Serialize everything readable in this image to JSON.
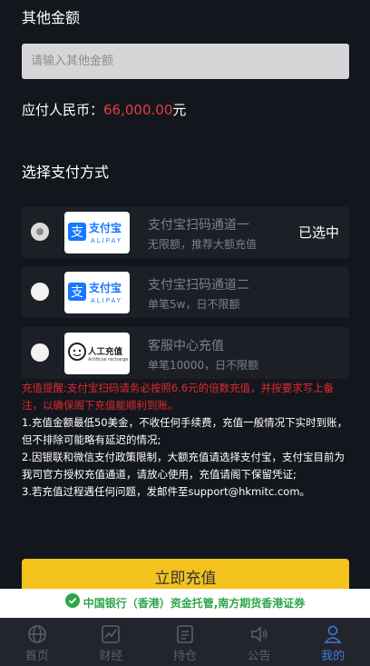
{
  "other_amount": {
    "label": "其他金额",
    "placeholder": "请输入其他金额"
  },
  "payable": {
    "label": "应付人民币：",
    "value": "66,000.00",
    "unit": "元",
    "value_color": "#e33d3d"
  },
  "payment_method": {
    "label": "选择支付方式",
    "options": [
      {
        "title": "支付宝扫码通道一",
        "subtitle": "无限额，推荐大额充值",
        "status": "已选中",
        "logo_text": "支付宝",
        "logo_sub": "ALIPAY",
        "selected": true
      },
      {
        "title": "支付宝扫码通道二",
        "subtitle": "单笔5w，日不限额",
        "logo_text": "支付宝",
        "logo_sub": "ALIPAY",
        "selected": false
      },
      {
        "title": "客服中心充值",
        "subtitle": "单笔10000，日不限额",
        "logo_text": "人工充值",
        "logo_sub": "Artificial recharge",
        "selected": false
      }
    ]
  },
  "notice": {
    "warning": "充值提醒:支付宝扫码请务必按照6.6元的倍数充值，并按要求写上备注，以确保阁下充值能顺利到账。",
    "items": [
      "1.充值金额最低50美金，不收任何手续费，充值一般情况下实时到账，但不排除可能略有延迟的情况;",
      "2.因银联和微信支付政策限制，大额充值请选择支付宝，支付宝目前为我司官方授权充值通道，请放心使用，充值请阁下保留凭证;",
      "3.若充值过程遇任何问题，发邮件至support@hkmitc.com。"
    ]
  },
  "submit_label": "立即充值",
  "banner_text": "中国银行（香港）资金托管,南方期货香港证券",
  "tabs": [
    {
      "label": "首页",
      "icon": "globe-icon",
      "active": false
    },
    {
      "label": "财经",
      "icon": "chart-icon",
      "active": false
    },
    {
      "label": "持仓",
      "icon": "ledger-icon",
      "active": false
    },
    {
      "label": "公告",
      "icon": "speaker-icon",
      "active": false
    },
    {
      "label": "我的",
      "icon": "user-icon",
      "active": true
    }
  ],
  "colors": {
    "accent": "#f4c21d",
    "active_tab": "#3d7bd9",
    "warning": "#e02b2b",
    "background": "#14161d"
  }
}
